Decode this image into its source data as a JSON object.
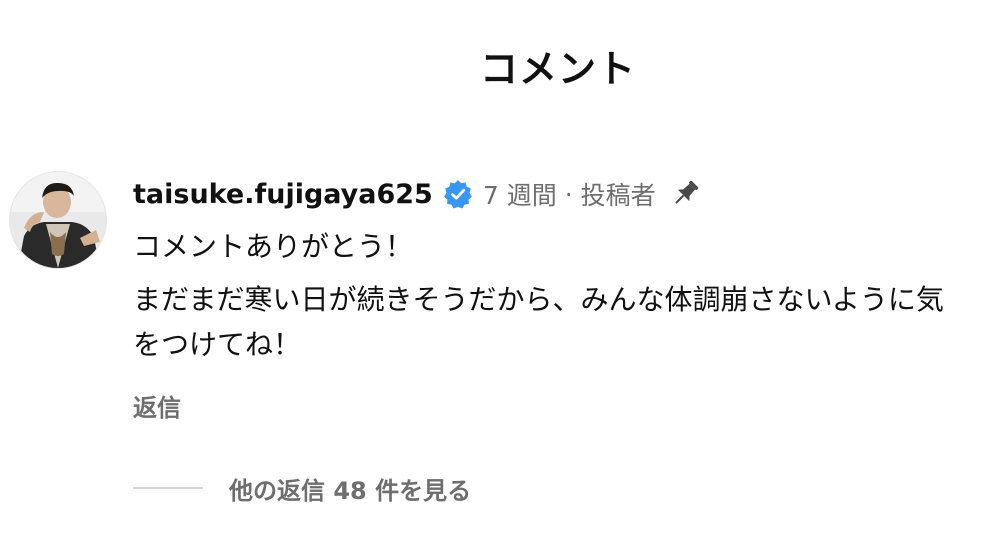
{
  "header": {
    "title": "コメント"
  },
  "comment": {
    "avatar_icon": "user-avatar-photo",
    "username": "taisuke.fujigaya625",
    "verified_icon": "verified-badge-icon",
    "time_ago": "7 週間",
    "separator": "·",
    "author_label": "投稿者",
    "pin_icon": "pin-icon",
    "text_line1": "コメントありがとう！",
    "text_line2": "まだまだ寒い日が続きそうだから、みんな体調崩さないように気をつけてね！",
    "reply_label": "返信",
    "view_replies_label": "他の返信 48 件を見る"
  },
  "colors": {
    "text_primary": "#111111",
    "text_secondary": "#6e6e6e",
    "verified_blue": "#3897f0",
    "divider": "#d5d5d5",
    "background": "#ffffff"
  }
}
